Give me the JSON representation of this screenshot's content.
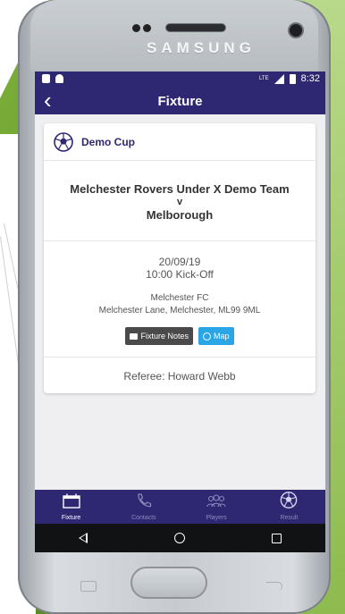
{
  "device": {
    "brand": "SAMSUNG"
  },
  "status": {
    "time": "8:32",
    "network": "LTE"
  },
  "header": {
    "title": "Fixture",
    "back_icon": "chevron-left-icon"
  },
  "fixture": {
    "competition": "Demo Cup",
    "home_team": "Melchester Rovers Under X Demo Team",
    "versus": "v",
    "away_team": "Melborough",
    "date": "20/09/19",
    "kickoff": "10:00 Kick-Off",
    "venue_name": "Melchester FC",
    "venue_address": "Melchester Lane, Melchester, ML99 9ML",
    "notes_button": "Fixture Notes",
    "map_button": "Map",
    "referee": "Referee: Howard Webb"
  },
  "tabs": [
    {
      "label": "Fixture",
      "icon": "calendar-icon",
      "active": true
    },
    {
      "label": "Contacts",
      "icon": "phone-icon",
      "active": false
    },
    {
      "label": "Players",
      "icon": "players-icon",
      "active": false
    },
    {
      "label": "Result",
      "icon": "football-icon",
      "active": false
    }
  ],
  "colors": {
    "primary": "#2e2872",
    "map_button": "#2aa6e6",
    "notes_button": "#4a4a4a",
    "inactive_tab": "#8c88bd"
  }
}
